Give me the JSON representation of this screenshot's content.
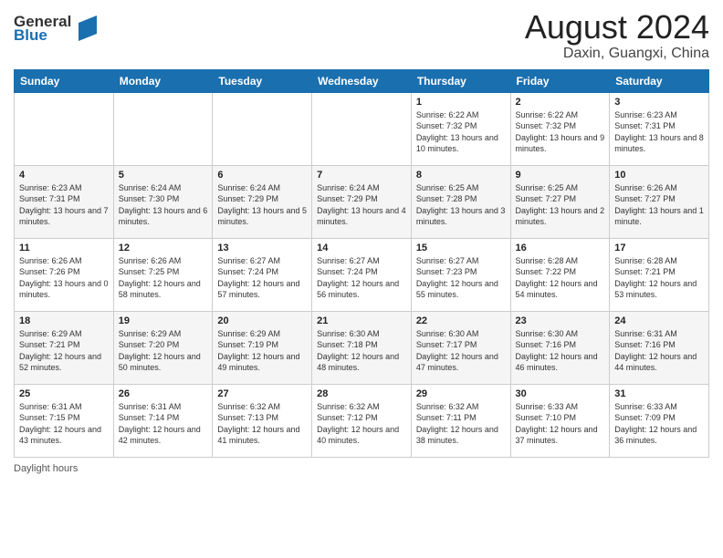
{
  "header": {
    "logo_line1": "General",
    "logo_line2": "Blue",
    "month_title": "August 2024",
    "location": "Daxin, Guangxi, China"
  },
  "days_of_week": [
    "Sunday",
    "Monday",
    "Tuesday",
    "Wednesday",
    "Thursday",
    "Friday",
    "Saturday"
  ],
  "weeks": [
    [
      {
        "day": "",
        "info": ""
      },
      {
        "day": "",
        "info": ""
      },
      {
        "day": "",
        "info": ""
      },
      {
        "day": "",
        "info": ""
      },
      {
        "day": "1",
        "info": "Sunrise: 6:22 AM\nSunset: 7:32 PM\nDaylight: 13 hours and 10 minutes."
      },
      {
        "day": "2",
        "info": "Sunrise: 6:22 AM\nSunset: 7:32 PM\nDaylight: 13 hours and 9 minutes."
      },
      {
        "day": "3",
        "info": "Sunrise: 6:23 AM\nSunset: 7:31 PM\nDaylight: 13 hours and 8 minutes."
      }
    ],
    [
      {
        "day": "4",
        "info": "Sunrise: 6:23 AM\nSunset: 7:31 PM\nDaylight: 13 hours and 7 minutes."
      },
      {
        "day": "5",
        "info": "Sunrise: 6:24 AM\nSunset: 7:30 PM\nDaylight: 13 hours and 6 minutes."
      },
      {
        "day": "6",
        "info": "Sunrise: 6:24 AM\nSunset: 7:29 PM\nDaylight: 13 hours and 5 minutes."
      },
      {
        "day": "7",
        "info": "Sunrise: 6:24 AM\nSunset: 7:29 PM\nDaylight: 13 hours and 4 minutes."
      },
      {
        "day": "8",
        "info": "Sunrise: 6:25 AM\nSunset: 7:28 PM\nDaylight: 13 hours and 3 minutes."
      },
      {
        "day": "9",
        "info": "Sunrise: 6:25 AM\nSunset: 7:27 PM\nDaylight: 13 hours and 2 minutes."
      },
      {
        "day": "10",
        "info": "Sunrise: 6:26 AM\nSunset: 7:27 PM\nDaylight: 13 hours and 1 minute."
      }
    ],
    [
      {
        "day": "11",
        "info": "Sunrise: 6:26 AM\nSunset: 7:26 PM\nDaylight: 13 hours and 0 minutes."
      },
      {
        "day": "12",
        "info": "Sunrise: 6:26 AM\nSunset: 7:25 PM\nDaylight: 12 hours and 58 minutes."
      },
      {
        "day": "13",
        "info": "Sunrise: 6:27 AM\nSunset: 7:24 PM\nDaylight: 12 hours and 57 minutes."
      },
      {
        "day": "14",
        "info": "Sunrise: 6:27 AM\nSunset: 7:24 PM\nDaylight: 12 hours and 56 minutes."
      },
      {
        "day": "15",
        "info": "Sunrise: 6:27 AM\nSunset: 7:23 PM\nDaylight: 12 hours and 55 minutes."
      },
      {
        "day": "16",
        "info": "Sunrise: 6:28 AM\nSunset: 7:22 PM\nDaylight: 12 hours and 54 minutes."
      },
      {
        "day": "17",
        "info": "Sunrise: 6:28 AM\nSunset: 7:21 PM\nDaylight: 12 hours and 53 minutes."
      }
    ],
    [
      {
        "day": "18",
        "info": "Sunrise: 6:29 AM\nSunset: 7:21 PM\nDaylight: 12 hours and 52 minutes."
      },
      {
        "day": "19",
        "info": "Sunrise: 6:29 AM\nSunset: 7:20 PM\nDaylight: 12 hours and 50 minutes."
      },
      {
        "day": "20",
        "info": "Sunrise: 6:29 AM\nSunset: 7:19 PM\nDaylight: 12 hours and 49 minutes."
      },
      {
        "day": "21",
        "info": "Sunrise: 6:30 AM\nSunset: 7:18 PM\nDaylight: 12 hours and 48 minutes."
      },
      {
        "day": "22",
        "info": "Sunrise: 6:30 AM\nSunset: 7:17 PM\nDaylight: 12 hours and 47 minutes."
      },
      {
        "day": "23",
        "info": "Sunrise: 6:30 AM\nSunset: 7:16 PM\nDaylight: 12 hours and 46 minutes."
      },
      {
        "day": "24",
        "info": "Sunrise: 6:31 AM\nSunset: 7:16 PM\nDaylight: 12 hours and 44 minutes."
      }
    ],
    [
      {
        "day": "25",
        "info": "Sunrise: 6:31 AM\nSunset: 7:15 PM\nDaylight: 12 hours and 43 minutes."
      },
      {
        "day": "26",
        "info": "Sunrise: 6:31 AM\nSunset: 7:14 PM\nDaylight: 12 hours and 42 minutes."
      },
      {
        "day": "27",
        "info": "Sunrise: 6:32 AM\nSunset: 7:13 PM\nDaylight: 12 hours and 41 minutes."
      },
      {
        "day": "28",
        "info": "Sunrise: 6:32 AM\nSunset: 7:12 PM\nDaylight: 12 hours and 40 minutes."
      },
      {
        "day": "29",
        "info": "Sunrise: 6:32 AM\nSunset: 7:11 PM\nDaylight: 12 hours and 38 minutes."
      },
      {
        "day": "30",
        "info": "Sunrise: 6:33 AM\nSunset: 7:10 PM\nDaylight: 12 hours and 37 minutes."
      },
      {
        "day": "31",
        "info": "Sunrise: 6:33 AM\nSunset: 7:09 PM\nDaylight: 12 hours and 36 minutes."
      }
    ]
  ],
  "footer": {
    "label": "Daylight hours"
  }
}
